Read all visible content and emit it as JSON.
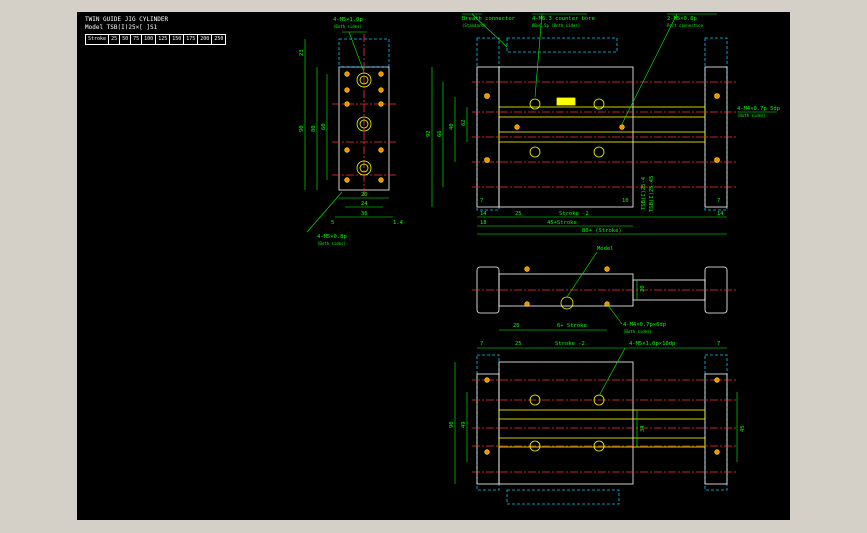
{
  "title": {
    "line1": "TWIN GUIDE JIG CYLINDER",
    "line2": "Model  TSB(I)25×[  ]S1"
  },
  "stroke_table": {
    "header": "Stroke",
    "values": [
      "25",
      "50",
      "75",
      "100",
      "125",
      "150",
      "175",
      "200",
      "250"
    ]
  },
  "front_view": {
    "callout_top": "4-M5×1.0p",
    "callout_top_sub": "(Both sides)",
    "callout_bottom": "4-M5×0.8p",
    "callout_bottom_sub": "(Both sides)",
    "dims": {
      "height_total": "23",
      "h90": "90",
      "h80": "80",
      "h60": "60",
      "w20": "20",
      "w24": "24",
      "w36": "36",
      "left5": "5",
      "right14": "1.4"
    }
  },
  "side_view": {
    "callout_breath": "Breath connector",
    "callout_breath_sub": "(Standard)",
    "callout_counterbore": "4-M6.3 counter bore",
    "callout_counterbore_sub": "Ø8×6.5p (Both sides)",
    "callout_right": "2-M5×0.8p",
    "callout_right_sub": "Port connection",
    "callout_side": "4-M4×0.7p 5dp",
    "callout_side_sub": "(Both sides)",
    "dims": {
      "h92": "92",
      "h66": "66",
      "h40": "40",
      "h62": "62",
      "d7": "7",
      "d14": "14",
      "d25": "25",
      "stroke": "Stroke -2",
      "d10": "10",
      "d18": "18",
      "span": "45+Stroke",
      "overall": "86+ (Stroke)",
      "r7": "7",
      "r14": "14",
      "tsb": "TSB(I)25-4",
      "tsb2": "TSB(I)25-45"
    }
  },
  "bottom_view": {
    "callout_top": "Model",
    "callout_side": "4-M4×0.7p×6dp",
    "callout_side_sub": "(Both sides)",
    "dims": {
      "d20": "20",
      "stroke": "6+ Stroke",
      "h20": "20"
    }
  },
  "top_view": {
    "callout": "4-M5×1.0p×10dp",
    "dims": {
      "d7": "7",
      "d25": "25",
      "stroke": "Stroke -2",
      "r7": "7",
      "h90": "90",
      "h49": "49",
      "h34": "34",
      "h45": "45"
    }
  }
}
